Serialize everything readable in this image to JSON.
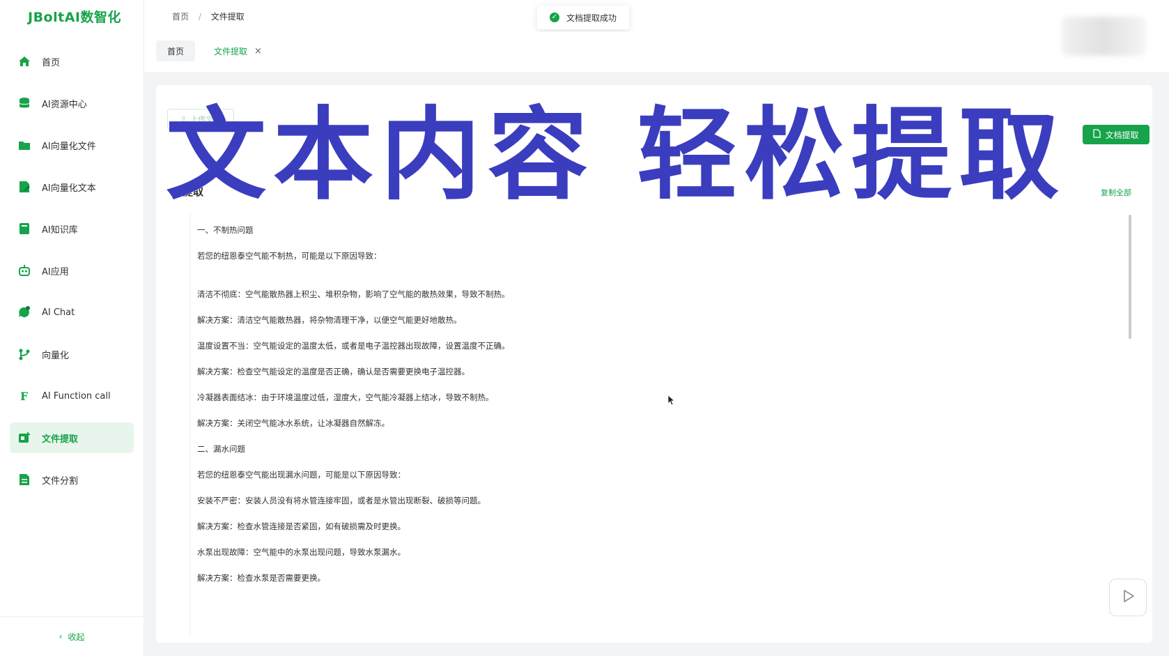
{
  "app": {
    "logo": "JBoltAI数智化"
  },
  "sidebar": {
    "items": [
      {
        "label": "首页",
        "icon": "home-icon",
        "active": false
      },
      {
        "label": "AI资源中心",
        "icon": "database-icon",
        "active": false
      },
      {
        "label": "AI向量化文件",
        "icon": "folder-icon",
        "active": false
      },
      {
        "label": "AI向量化文本",
        "icon": "document-edit-icon",
        "active": false
      },
      {
        "label": "AI知识库",
        "icon": "book-icon",
        "active": false
      },
      {
        "label": "AI应用",
        "icon": "robot-icon",
        "active": false
      },
      {
        "label": "AI Chat",
        "icon": "chat-icon",
        "active": false
      },
      {
        "label": "向量化",
        "icon": "branch-icon",
        "active": false
      },
      {
        "label": "AI Function call",
        "icon": "function-icon",
        "active": true
      },
      {
        "label": "文件提取",
        "icon": "file-extract-icon",
        "active": true
      },
      {
        "label": "文件分割",
        "icon": "file-split-icon",
        "active": false
      }
    ],
    "collapse_label": "收起"
  },
  "header": {
    "breadcrumb": [
      "首页",
      "文件提取"
    ],
    "toast": "文档提取成功"
  },
  "tabs": [
    {
      "label": "首页"
    },
    {
      "label": "文件提取"
    }
  ],
  "main": {
    "upload_label": "上传文件",
    "extract_label": "文档提取",
    "section_title": "提取",
    "copy_all_label": "复制全部",
    "lines": [
      "一、不制热问题",
      "若您的纽恩泰空气能不制热，可能是以下原因导致：",
      "",
      "清洁不彻底：空气能散热器上积尘、堆积杂物，影响了空气能的散热效果，导致不制热。",
      "解决方案：清洁空气能散热器，将杂物清理干净，以便空气能更好地散热。",
      "温度设置不当：空气能设定的温度太低，或者是电子温控器出现故障，设置温度不正确。",
      "解决方案：检查空气能设定的温度是否正确，确认是否需要更换电子温控器。",
      "冷凝器表面结冰：由于环境温度过低，湿度大，空气能冷凝器上结冰，导致不制热。",
      "解决方案：关闭空气能冰水系统，让冰凝器自然解冻。",
      "二、漏水问题",
      "若您的纽恩泰空气能出现漏水问题，可能是以下原因导致：",
      "安装不严密：安装人员没有将水管连接牢固，或者是水管出现断裂、破损等问题。",
      "解决方案：检查水管连接是否紧固，如有破损需及时更换。",
      "水泵出现故障：空气能中的水泵出现问题，导致水泵漏水。",
      "解决方案：检查水泵是否需要更换。"
    ]
  },
  "overlay": {
    "title": "文本内容  轻松提取"
  },
  "colors": {
    "accent": "#16a34a",
    "overlay": "#3b3dbf",
    "active_bg": "#e8f5ec"
  }
}
